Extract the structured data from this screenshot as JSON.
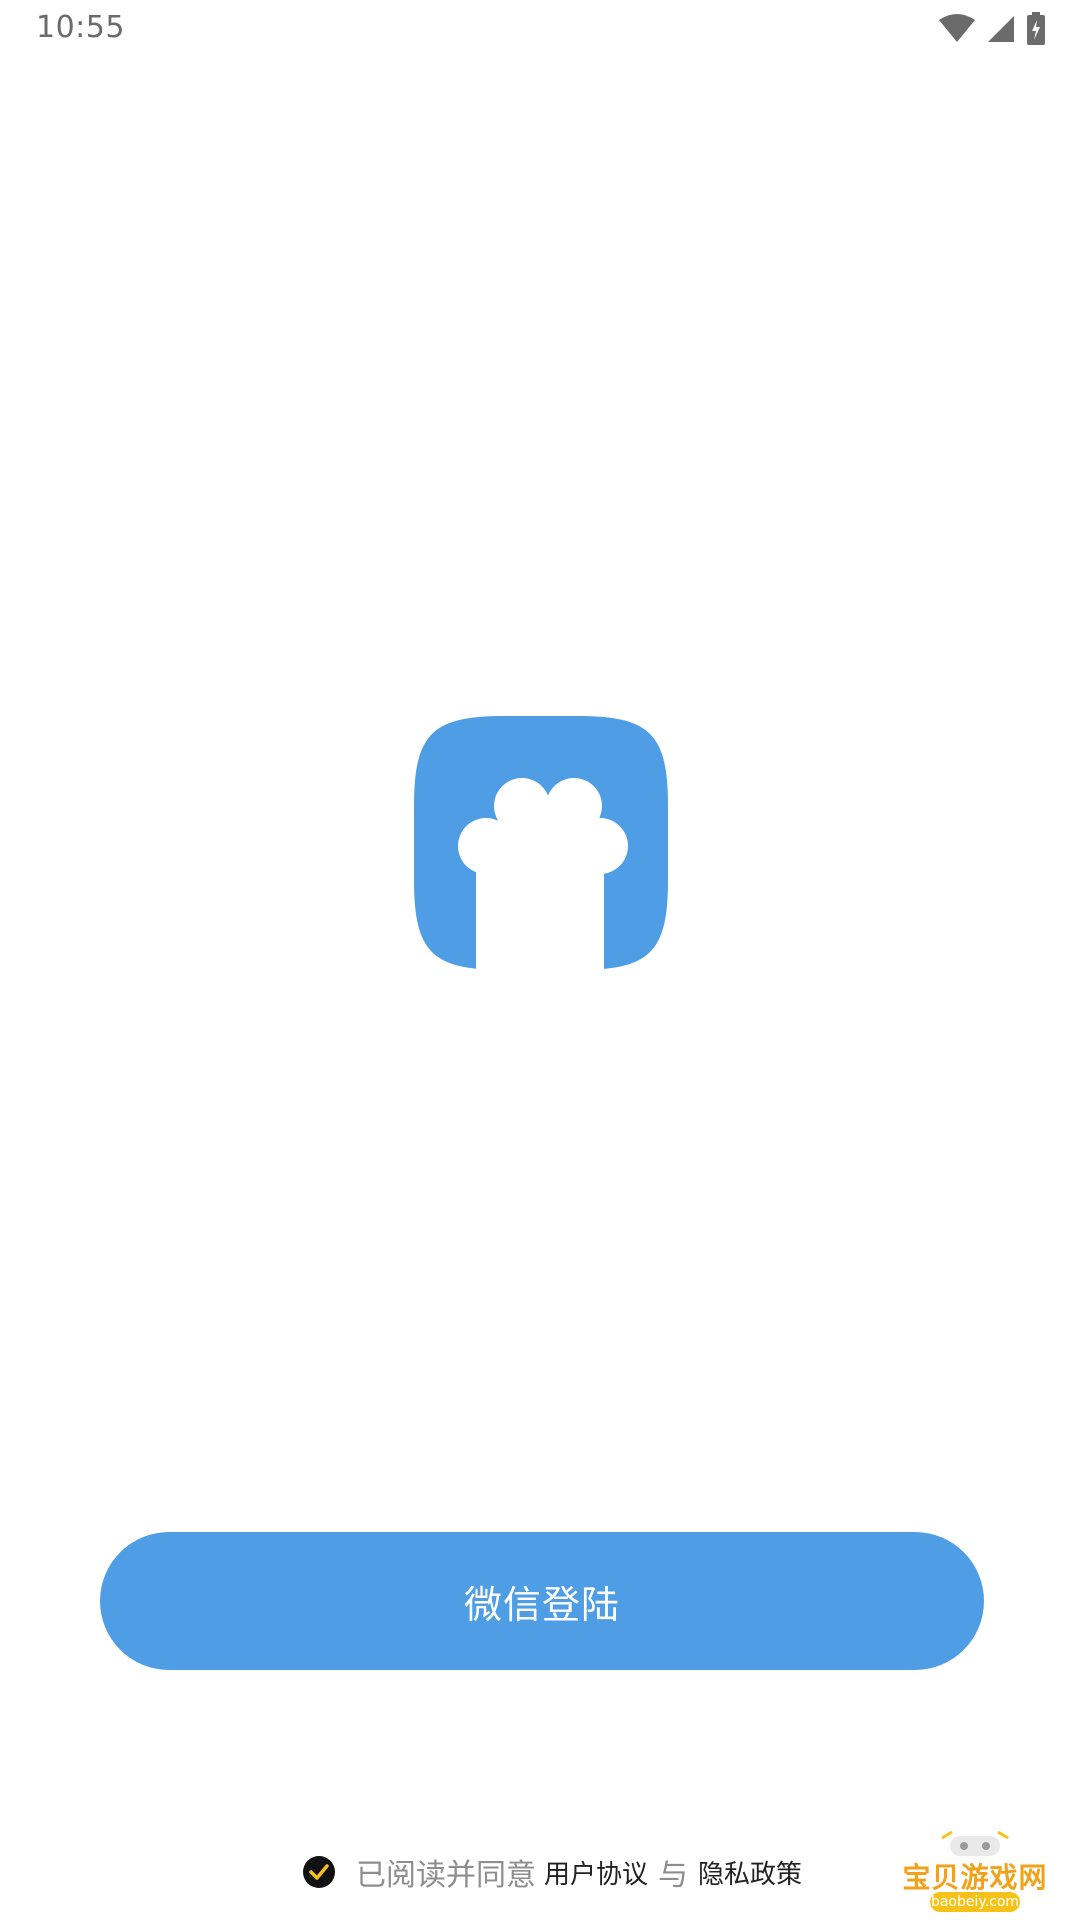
{
  "status_bar": {
    "time": "10:55",
    "icons": [
      "wifi-icon",
      "cellular-signal-icon",
      "battery-charging-icon"
    ]
  },
  "app": {
    "logo_icon": "paw-logo-icon",
    "brand_color": "#4f9de5"
  },
  "login": {
    "wechat_button_label": "微信登陆"
  },
  "agreement": {
    "checked": true,
    "prefix": "已阅读并同意",
    "user_agreement_link": "用户协议",
    "conjunction": "与",
    "privacy_policy_link": "隐私政策"
  },
  "watermark": {
    "title": "宝贝游戏网",
    "url": "baobeiy.com",
    "accent_color": "#f1a21b"
  }
}
